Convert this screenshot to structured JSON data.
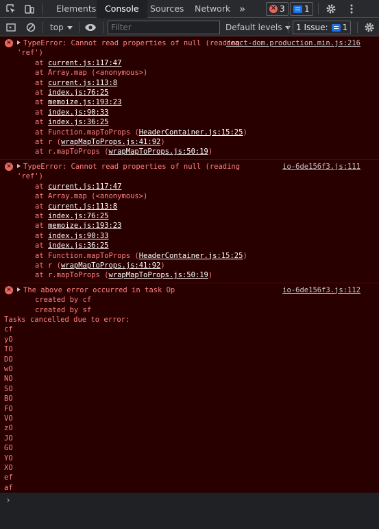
{
  "tabs": [
    {
      "label": "Elements"
    },
    {
      "label": "Console"
    },
    {
      "label": "Sources"
    },
    {
      "label": "Network"
    }
  ],
  "more_tabs_glyph": "»",
  "error_count": "3",
  "message_count": "1",
  "toolbar": {
    "context": "top",
    "filter_placeholder": "Filter",
    "levels": "Default levels",
    "issues_label": "1 Issue:",
    "issues_count": "1"
  },
  "messages": [
    {
      "head": "TypeError: Cannot read properties of null (reading 'ref')",
      "source": "react-dom.production.min.js:216",
      "frames": [
        {
          "pre": "at ",
          "link": "current.js:117:47",
          "post": ""
        },
        {
          "pre": "at Array.map (<anonymous>)",
          "link": "",
          "post": ""
        },
        {
          "pre": "at ",
          "link": "current.js:113:8",
          "post": ""
        },
        {
          "pre": "at ",
          "link": "index.js:76:25",
          "post": ""
        },
        {
          "pre": "at ",
          "link": "memoize.js:193:23",
          "post": ""
        },
        {
          "pre": "at ",
          "link": "index.js:90:33",
          "post": ""
        },
        {
          "pre": "at ",
          "link": "index.js:36:25",
          "post": ""
        },
        {
          "pre": "at Function.mapToProps (",
          "link": "HeaderContainer.js:15:25",
          "post": ")"
        },
        {
          "pre": "at r (",
          "link": "wrapMapToProps.js:41:92",
          "post": ")"
        },
        {
          "pre": "at r.mapToProps (",
          "link": "wrapMapToProps.js:50:19",
          "post": ")"
        }
      ]
    },
    {
      "head": "TypeError: Cannot read properties of null (reading 'ref')",
      "source": "io-6de156f3.js:111",
      "frames": [
        {
          "pre": "at ",
          "link": "current.js:117:47",
          "post": ""
        },
        {
          "pre": "at Array.map (<anonymous>)",
          "link": "",
          "post": ""
        },
        {
          "pre": "at ",
          "link": "current.js:113:8",
          "post": ""
        },
        {
          "pre": "at ",
          "link": "index.js:76:25",
          "post": ""
        },
        {
          "pre": "at ",
          "link": "memoize.js:193:23",
          "post": ""
        },
        {
          "pre": "at ",
          "link": "index.js:90:33",
          "post": ""
        },
        {
          "pre": "at ",
          "link": "index.js:36:25",
          "post": ""
        },
        {
          "pre": "at Function.mapToProps (",
          "link": "HeaderContainer.js:15:25",
          "post": ")"
        },
        {
          "pre": "at r (",
          "link": "wrapMapToProps.js:41:92",
          "post": ")"
        },
        {
          "pre": "at r.mapToProps (",
          "link": "wrapMapToProps.js:50:19",
          "post": ")"
        }
      ]
    }
  ],
  "task_error": {
    "head": "The above error occurred in task Op",
    "source": "io-6de156f3.js:112",
    "created_by": [
      "created by cf",
      "created by sf"
    ],
    "cancelled_heading": "Tasks cancelled due to error:",
    "tasks": [
      "cf",
      "yO",
      "TO",
      "DO",
      "wO",
      "NO",
      "SO",
      "BO",
      "FO",
      "VO",
      "zO",
      "JO",
      "GO",
      "YO",
      "XO",
      "ef",
      "af"
    ]
  },
  "prompt_glyph": "›",
  "colors": {
    "error_text": "#ff8080",
    "error_bg": "#290000",
    "error_border": "#5c0000",
    "error_icon": "#e46962",
    "accent": "#1a73e8",
    "prompt": "#8ab4f8"
  },
  "icons": [
    "inspect-element-icon",
    "device-toolbar-icon",
    "settings-icon",
    "more-vertical-icon",
    "sidebar-toggle-icon",
    "clear-console-icon",
    "eye-icon",
    "error-icon"
  ]
}
